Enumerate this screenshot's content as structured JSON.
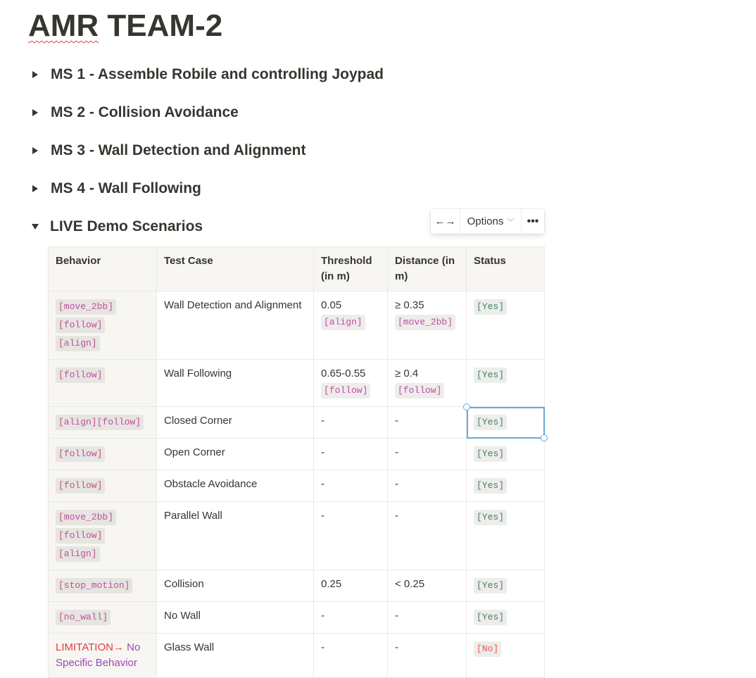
{
  "page": {
    "title_underlined": "AMR",
    "title_rest": " TEAM-2"
  },
  "toggles": [
    {
      "label": "MS 1 - Assemble Robile and controlling Joypad",
      "expanded": false
    },
    {
      "label": "MS 2 - Collision Avoidance",
      "expanded": false
    },
    {
      "label": "MS 3 - Wall Detection and Alignment",
      "expanded": false
    },
    {
      "label": "MS 4 - Wall Following",
      "expanded": false
    },
    {
      "label": "LIVE Demo Scenarios",
      "expanded": true
    }
  ],
  "toolbar": {
    "expand_icon": "←→",
    "options_label": "Options",
    "chevron": "﹀",
    "more_icon": "•••"
  },
  "table": {
    "headers": [
      "Behavior",
      "Test Case",
      "Threshold (in m)",
      "Distance (in m)",
      "Status"
    ],
    "rows": [
      {
        "behavior": [
          "[move_2bb]",
          "[follow]",
          "[align]"
        ],
        "test_case": "Wall Detection and Alignment",
        "threshold": "0.05",
        "threshold_tag": "[align]",
        "distance": "≥ 0.35",
        "distance_tag": "[move_2bb]",
        "status": "[Yes]"
      },
      {
        "behavior": [
          "[follow]"
        ],
        "test_case": "Wall Following",
        "threshold": "0.65-0.55",
        "threshold_tag": "[follow]",
        "distance": "≥ 0.4",
        "distance_tag": "[follow]",
        "status": "[Yes]"
      },
      {
        "behavior": [
          "[align][follow]"
        ],
        "test_case": "Closed Corner",
        "threshold": "-",
        "distance": "-",
        "status": "[Yes]"
      },
      {
        "behavior": [
          "[follow]"
        ],
        "test_case": "Open Corner",
        "threshold": "-",
        "distance": "-",
        "status": "[Yes]"
      },
      {
        "behavior": [
          "[follow]"
        ],
        "test_case": "Obstacle Avoidance",
        "threshold": "-",
        "distance": "-",
        "status": "[Yes]"
      },
      {
        "behavior": [
          "[move_2bb]",
          "[follow]",
          "[align]"
        ],
        "test_case": "Parallel Wall",
        "threshold": "-",
        "distance": "-",
        "status": "[Yes]"
      },
      {
        "behavior": [
          "[stop_motion]"
        ],
        "test_case": "Collision",
        "threshold": "0.25",
        "distance": "< 0.25",
        "status": "[Yes]"
      },
      {
        "behavior": [
          "[no_wall]"
        ],
        "test_case": "No Wall",
        "threshold": "-",
        "distance": "-",
        "status": "[Yes]"
      },
      {
        "limitation_red": "LIMITATION→",
        "limitation_purple": " No Specific Behavior",
        "test_case": "Glass Wall",
        "threshold": "-",
        "distance": "-",
        "status": "[No]"
      }
    ]
  },
  "colors": {
    "text": "#37352f",
    "code_pink": "#c14d9e",
    "yes_green": "#448361",
    "no_red": "#eb5757",
    "selection_blue": "#6aa9d9"
  }
}
